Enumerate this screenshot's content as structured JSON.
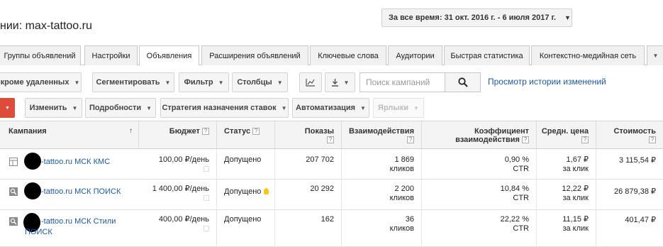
{
  "header": {
    "title": "нии: max-tattoo.ru",
    "date_range": "За все время: 31 окт. 2016 г. - 6 июля 2017 г."
  },
  "tabs": [
    {
      "label": "Группы объявлений"
    },
    {
      "label": "Настройки"
    },
    {
      "label": "Объявления"
    },
    {
      "label": "Расширения объявлений"
    },
    {
      "label": "Ключевые слова"
    },
    {
      "label": "Аудитории"
    },
    {
      "label": "Быстрая статистика"
    },
    {
      "label": "Контекстно-медийная сеть"
    }
  ],
  "toolbar1": {
    "filter_status": "кроме удаленных",
    "segment": "Сегментировать",
    "filter": "Фильтр",
    "columns": "Столбцы",
    "search_placeholder": "Поиск кампаний",
    "history_link": "Просмотр истории изменений"
  },
  "toolbar2": {
    "edit": "Изменить",
    "details": "Подробности",
    "bid_strategy": "Стратегия назначения ставок",
    "automation": "Автоматизация",
    "labels": "Ярлыки"
  },
  "table": {
    "columns": {
      "campaign": "Кампания",
      "budget": "Бюджет",
      "status": "Статус",
      "impressions": "Показы",
      "interactions": "Взаимодействия",
      "rate_line1": "Коэффициент",
      "rate_line2": "взаимодействия",
      "avg_cost": "Средн. цена",
      "cost": "Стоимость"
    },
    "rows": [
      {
        "icon": "display-campaign-icon",
        "campaign_line1": "-tattoo.ru МСК КМС",
        "campaign_line2": "",
        "budget": "100,00 ₽/день",
        "status": "Допущено",
        "impressions": "207 702",
        "interactions": "1 869",
        "interactions_unit": "кликов",
        "rate": "0,90 %",
        "rate_unit": "CTR",
        "avg_cost": "1,67 ₽",
        "avg_cost_unit": "за клик",
        "cost": "3 115,54 ₽"
      },
      {
        "icon": "search-campaign-icon",
        "campaign_line1": "-tattoo.ru МСК ПОИСК",
        "campaign_line2": "",
        "budget": "1 400,00 ₽/день",
        "status": "Допущено",
        "impressions": "20 292",
        "interactions": "2 200",
        "interactions_unit": "кликов",
        "rate": "10,84 %",
        "rate_unit": "CTR",
        "avg_cost": "12,22 ₽",
        "avg_cost_unit": "за клик",
        "cost": "26 879,38 ₽"
      },
      {
        "icon": "search-campaign-icon",
        "campaign_line1": "-tattoo.ru МСК Стили",
        "campaign_line2": "ПОИСК",
        "budget": "400,00 ₽/день",
        "status": "Допущено",
        "impressions": "162",
        "interactions": "36",
        "interactions_unit": "кликов",
        "rate": "22,22 %",
        "rate_unit": "CTR",
        "avg_cost": "11,15 ₽",
        "avg_cost_unit": "за клик",
        "cost": "401,47 ₽"
      }
    ]
  },
  "colors": {
    "link": "#1a5aa8",
    "primary_red": "#dd4b39",
    "bulb": "#f5c518"
  }
}
